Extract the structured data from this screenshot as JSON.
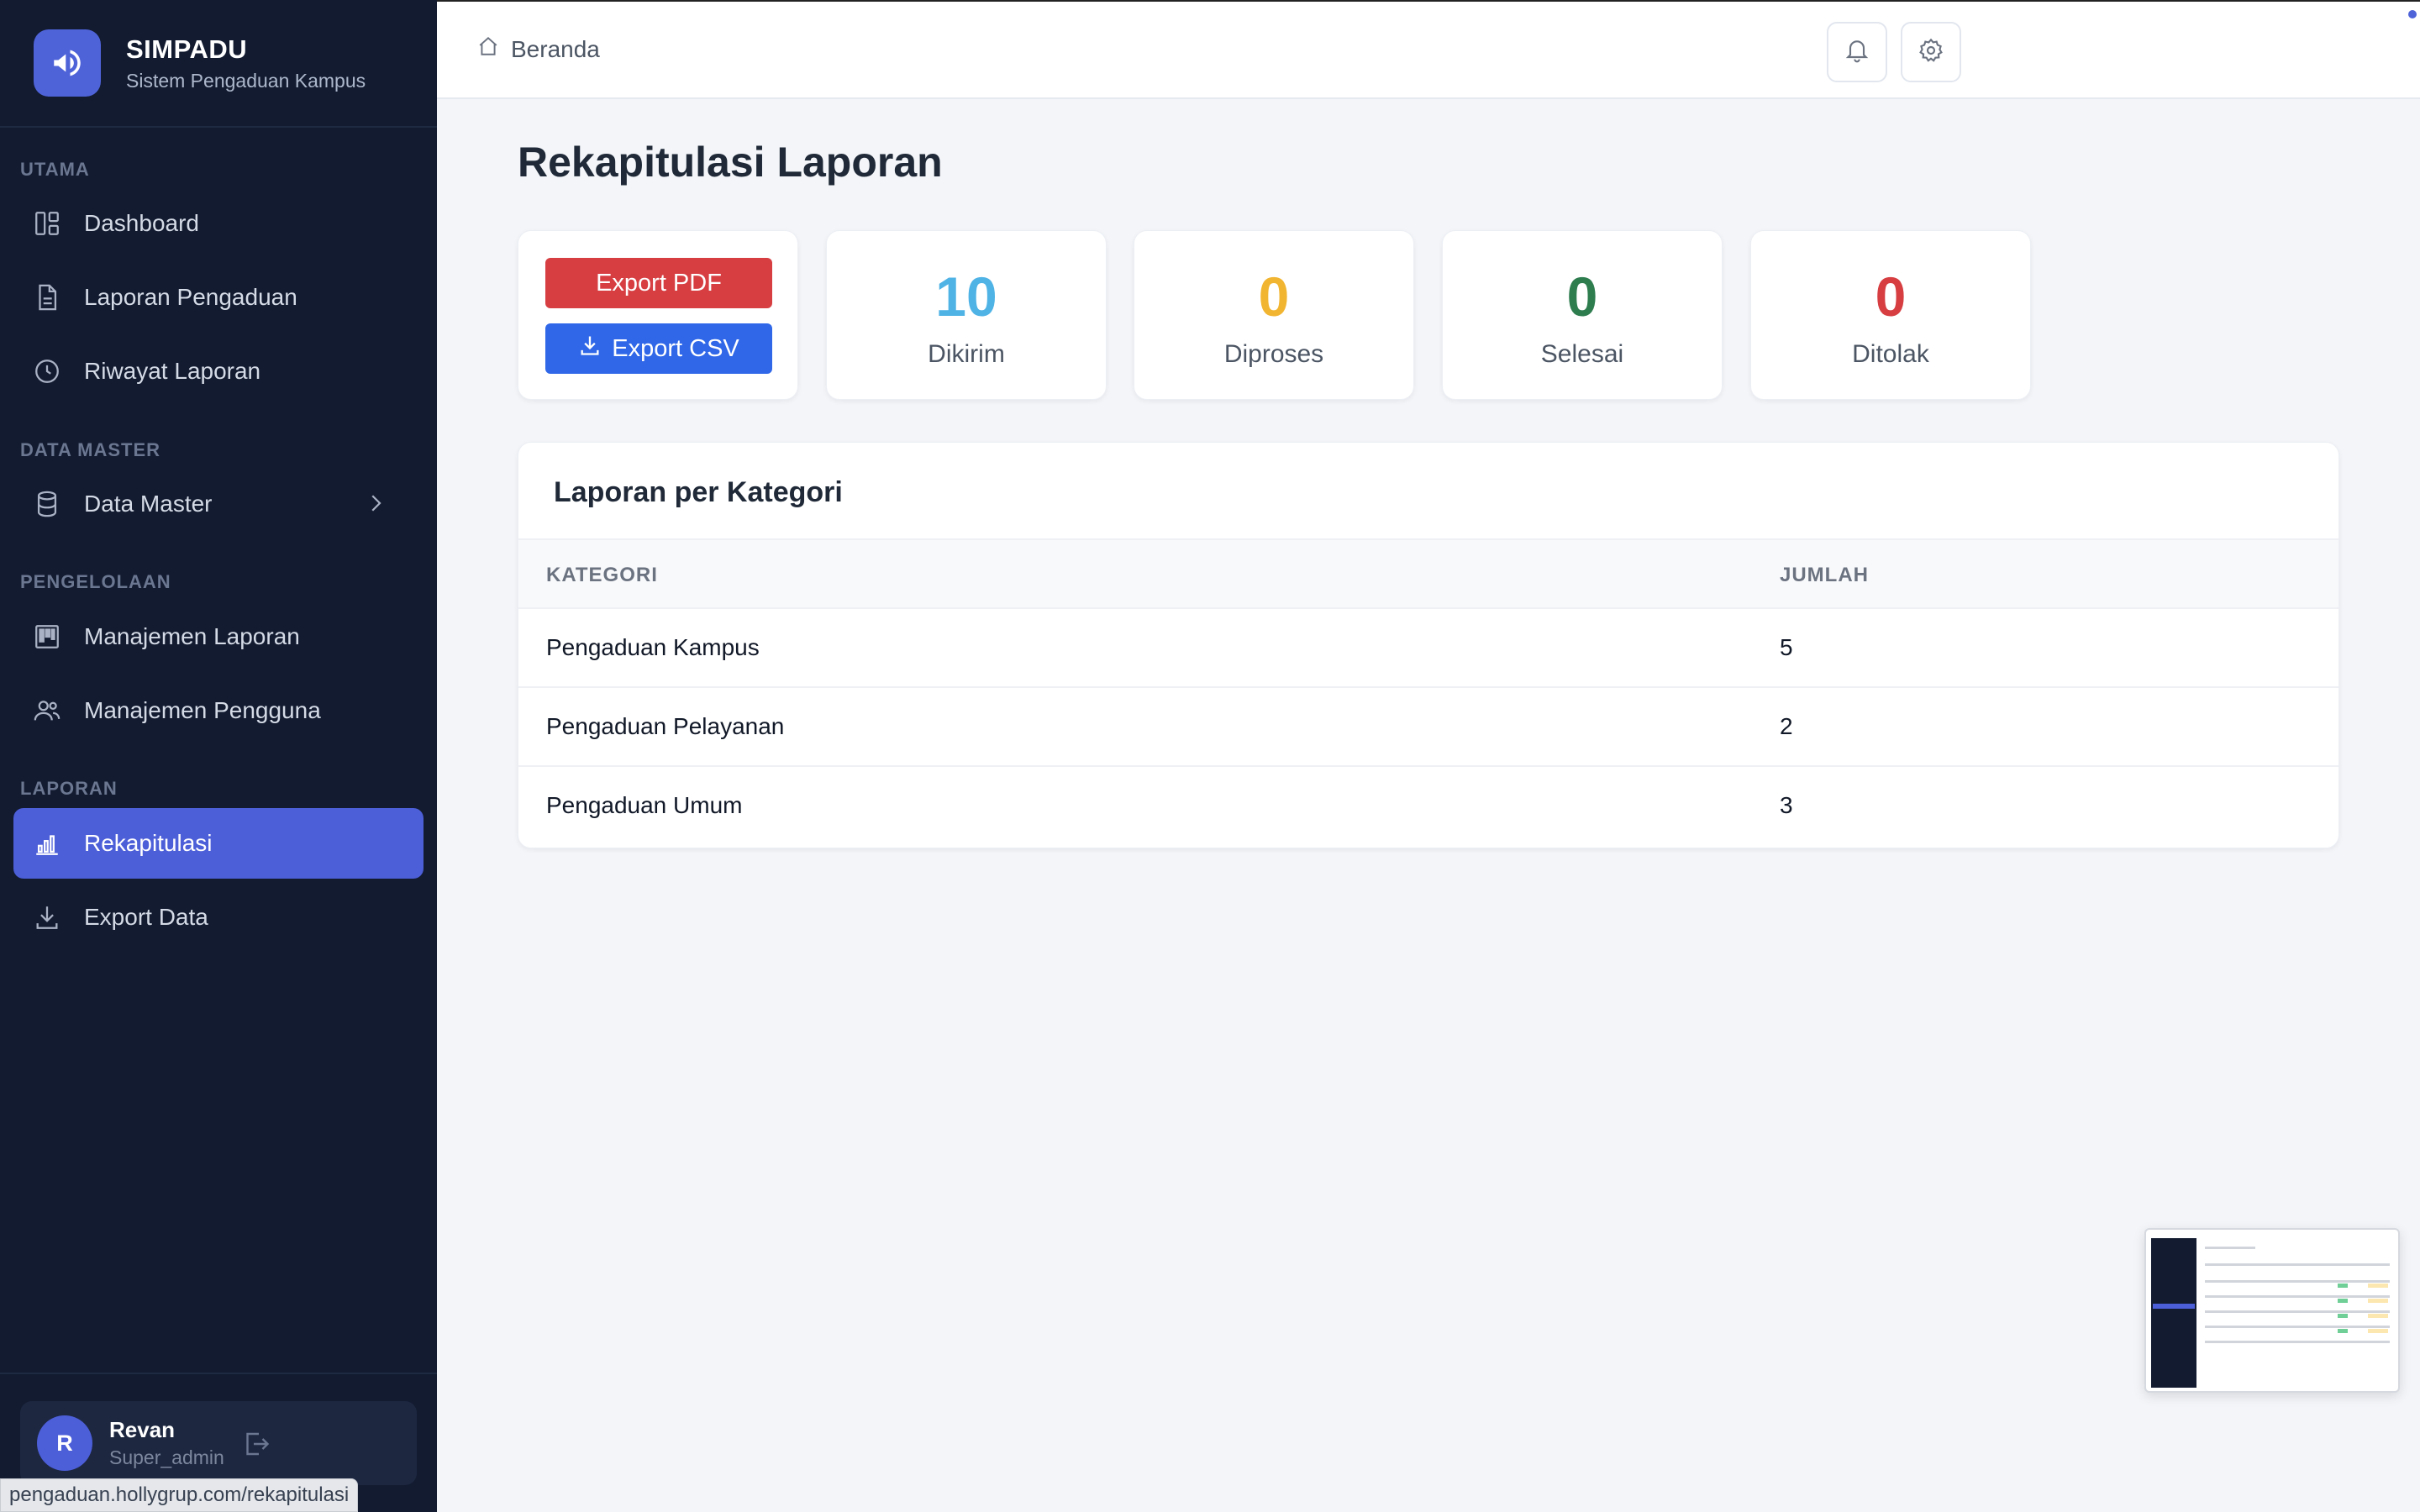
{
  "brand": {
    "name": "SIMPADU",
    "subtitle": "Sistem Pengaduan Kampus"
  },
  "sidebar": {
    "sections": {
      "utama": "UTAMA",
      "data_master": "DATA MASTER",
      "pengelolaan": "PENGELOLAAN",
      "laporan": "LAPORAN"
    },
    "items": {
      "dashboard": "Dashboard",
      "laporan_pengaduan": "Laporan Pengaduan",
      "riwayat_laporan": "Riwayat Laporan",
      "data_master": "Data Master",
      "manajemen_laporan": "Manajemen Laporan",
      "manajemen_pengguna": "Manajemen Pengguna",
      "rekapitulasi": "Rekapitulasi",
      "export_data": "Export Data"
    },
    "active": "rekapitulasi"
  },
  "user": {
    "initial": "R",
    "name": "Revan",
    "role": "Super_admin"
  },
  "status_bar": {
    "url": "pengaduan.hollygrup.com/rekapitulasi"
  },
  "topbar": {
    "breadcrumb": "Beranda"
  },
  "page": {
    "title": "Rekapitulasi Laporan"
  },
  "actions": {
    "export_pdf": "Export PDF",
    "export_csv": "Export CSV"
  },
  "stats": [
    {
      "value": "10",
      "label": "Dikirim",
      "color": "#4fb3e6"
    },
    {
      "value": "0",
      "label": "Diproses",
      "color": "#f2b531"
    },
    {
      "value": "0",
      "label": "Selesai",
      "color": "#2e7d4f"
    },
    {
      "value": "0",
      "label": "Ditolak",
      "color": "#d63e42"
    }
  ],
  "category_table": {
    "title": "Laporan per Kategori",
    "headers": {
      "kategori": "KATEGORI",
      "jumlah": "JUMLAH"
    },
    "rows": [
      {
        "kategori": "Pengaduan Kampus",
        "jumlah": "5"
      },
      {
        "kategori": "Pengaduan Pelayanan",
        "jumlah": "2"
      },
      {
        "kategori": "Pengaduan Umum",
        "jumlah": "3"
      }
    ]
  },
  "colors": {
    "accent": "#4c5ed8",
    "sidebar_bg": "#121b30",
    "export_pdf": "#d63e42",
    "export_csv": "#2f67e8"
  }
}
